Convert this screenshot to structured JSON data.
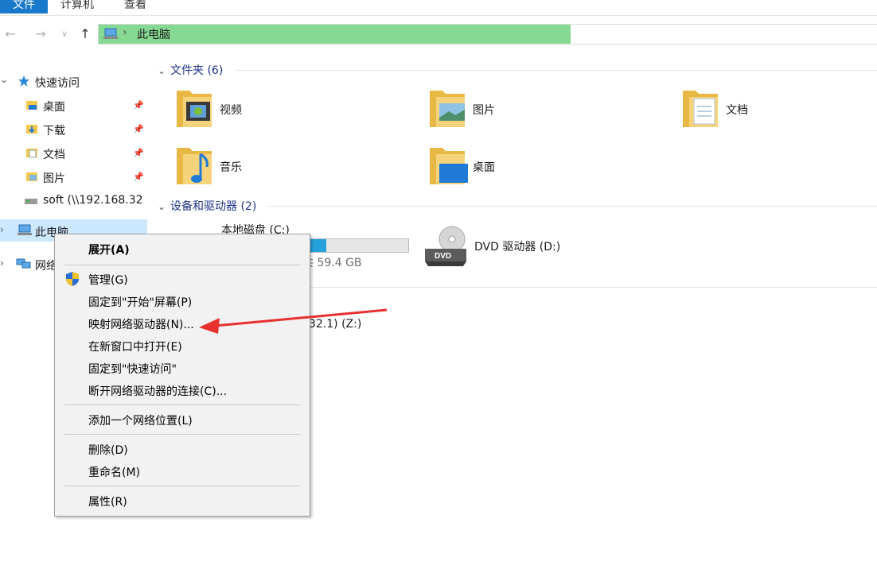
{
  "ribbon": {
    "tabs": [
      "文件",
      "计算机",
      "查看"
    ]
  },
  "address": {
    "path": "此电脑"
  },
  "nav": {
    "quick_access": "快速访问",
    "items": [
      {
        "label": "桌面",
        "pinned": true
      },
      {
        "label": "下载",
        "pinned": true
      },
      {
        "label": "文档",
        "pinned": true
      },
      {
        "label": "图片",
        "pinned": true
      },
      {
        "label": "soft (\\\\192.168.32",
        "pinned": false
      }
    ],
    "this_pc": "此电脑",
    "network": "网络"
  },
  "content": {
    "folders_header": "文件夹 (6)",
    "folders": [
      "视频",
      "图片",
      "文档",
      "音乐",
      "桌面"
    ],
    "devices_header": "设备和驱动器 (2)",
    "drive_c": {
      "name": "本地磁盘 (C:)",
      "free_text": "共 59.4 GB",
      "used_fraction": 0.56
    },
    "drive_d": {
      "name": "DVD 驱动器 (D:)",
      "badge": "DVD"
    },
    "network_drive_partial": "32.1) (Z:)"
  },
  "context_menu": {
    "items": [
      {
        "label": "展开(A)",
        "bold": true
      },
      {
        "label": "管理(G)",
        "shield": true
      },
      {
        "label": "固定到\"开始\"屏幕(P)"
      },
      {
        "label": "映射网络驱动器(N)..."
      },
      {
        "label": "在新窗口中打开(E)"
      },
      {
        "label": "固定到\"快速访问\""
      },
      {
        "label": "断开网络驱动器的连接(C)..."
      },
      {
        "label": "添加一个网络位置(L)"
      },
      {
        "label": "删除(D)"
      },
      {
        "label": "重命名(M)"
      },
      {
        "label": "属性(R)"
      }
    ]
  },
  "colors": {
    "accent": "#1979ca",
    "address_fill": "#86d993",
    "selection": "#cce8ff",
    "arrow": "#e8302e",
    "drive_bar": "#26a0da"
  }
}
